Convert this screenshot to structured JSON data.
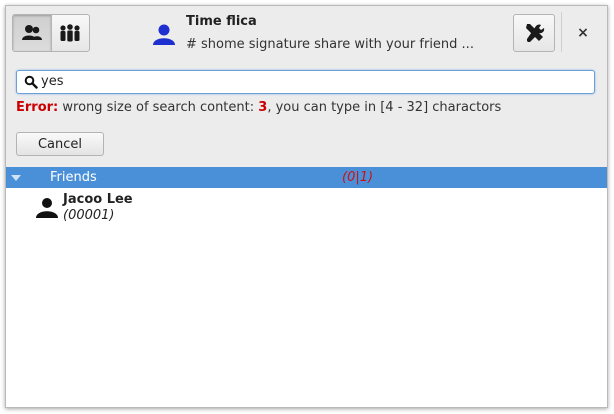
{
  "header": {
    "app_name": "Time flica",
    "signature": "# shome signature share with your friend ..."
  },
  "mode_switch": {
    "buttons": [
      {
        "icon": "contacts-icon",
        "active": true
      },
      {
        "icon": "groups-icon",
        "active": false
      }
    ]
  },
  "controls": {
    "tools_icon": "tools-icon",
    "close_label": "×"
  },
  "search": {
    "value": "yes",
    "icon": "search-icon"
  },
  "error": {
    "label": "Error:",
    "message_before": " wrong size of search content: ",
    "count": "3",
    "message_after": ", you can type in [4 - 32] charactors"
  },
  "cancel_label": "Cancel",
  "friend_list": {
    "group": {
      "name": "Friends",
      "count": "(0|1)",
      "expanded": true
    },
    "items": [
      {
        "name": "Jacoo Lee",
        "id": "(00001)"
      }
    ]
  },
  "colors": {
    "selection": "#4a90d9",
    "error": "#cc0000",
    "avatar": "#1e2fd0"
  }
}
